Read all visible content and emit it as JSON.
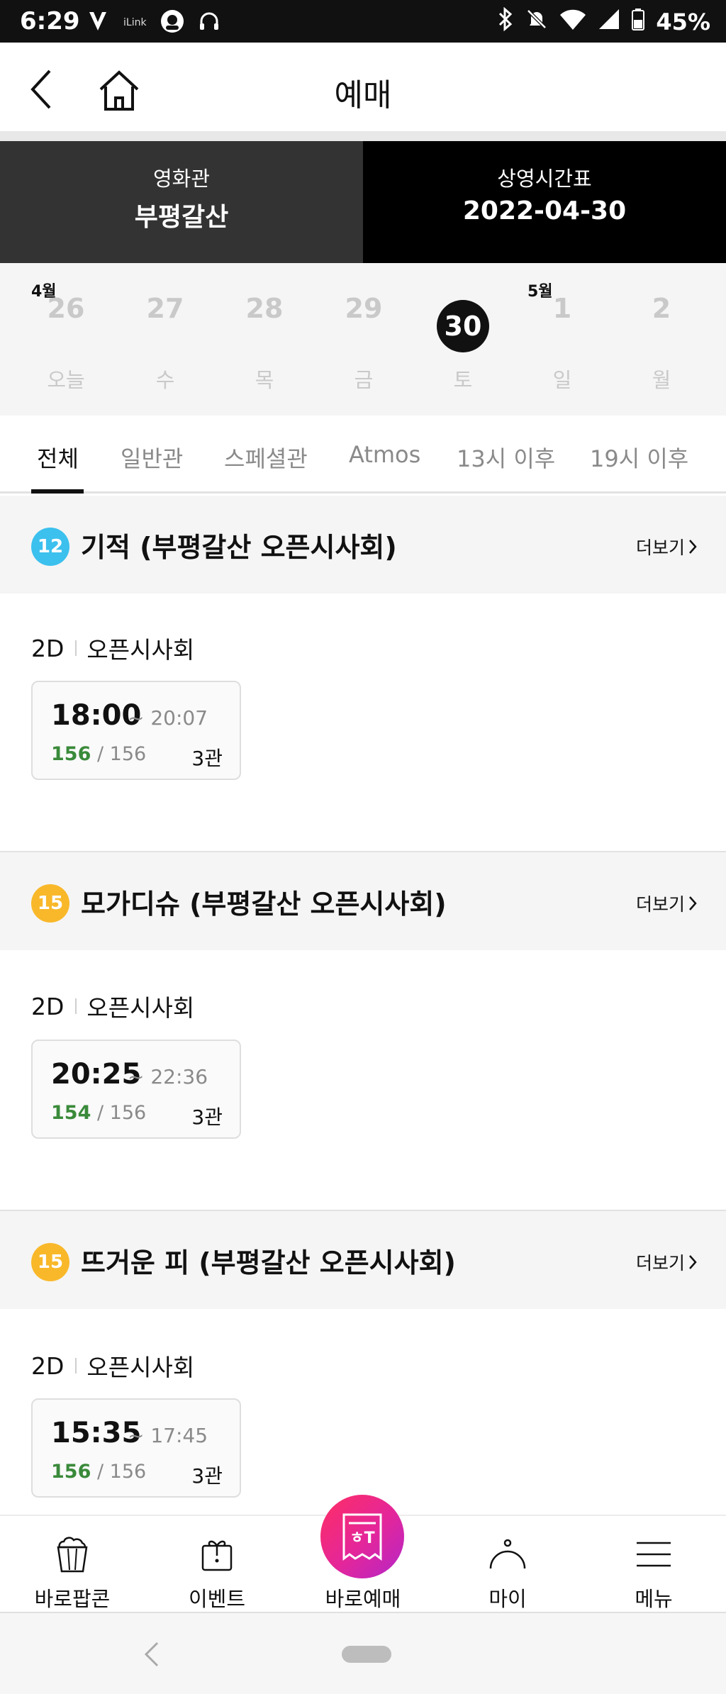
{
  "status_bar": {
    "time": "6:29",
    "battery": "45%",
    "left_icons": [
      "vpn-icon",
      "ilink-icon",
      "headset-app-icon",
      "headphones-icon"
    ],
    "right_icons": [
      "bluetooth-icon",
      "mute-icon",
      "wifi-icon",
      "signal-icon",
      "battery-icon"
    ],
    "ilink_label": "iLink"
  },
  "header": {
    "title": "예매",
    "back_icon": "chevron-left-icon",
    "home_icon": "home-icon"
  },
  "selector": {
    "theater_label": "영화관",
    "theater_value": "부평갈산",
    "schedule_label": "상영시간표",
    "schedule_value": "2022-04-30",
    "colors": {
      "theater_bg": "#333333",
      "schedule_bg": "#000000"
    }
  },
  "dates": {
    "months": [
      {
        "label": "4월"
      },
      {
        "label": "5월"
      }
    ],
    "days": [
      {
        "num": "26",
        "weekday": "오늘",
        "selected": false
      },
      {
        "num": "27",
        "weekday": "수",
        "selected": false
      },
      {
        "num": "28",
        "weekday": "목",
        "selected": false
      },
      {
        "num": "29",
        "weekday": "금",
        "selected": false
      },
      {
        "num": "30",
        "weekday": "토",
        "selected": true
      },
      {
        "num": "1",
        "weekday": "일",
        "selected": false
      },
      {
        "num": "2",
        "weekday": "월",
        "selected": false
      }
    ]
  },
  "tabs": [
    {
      "label": "전체",
      "active": true
    },
    {
      "label": "일반관",
      "active": false
    },
    {
      "label": "스페셜관",
      "active": false
    },
    {
      "label": "Atmos",
      "active": false
    },
    {
      "label": "13시 이후",
      "active": false
    },
    {
      "label": "19시 이후",
      "active": false
    }
  ],
  "movies": [
    {
      "rating": "12",
      "rating_color": "#3cc0ee",
      "title": "기적 (부평갈산 오픈시사회)",
      "more": "더보기",
      "format": "2D",
      "type": "오픈시사회",
      "showtime": {
        "start": "18:00",
        "end": "~ 20:07",
        "remaining": "156",
        "total": "/ 156",
        "hall": "3관"
      }
    },
    {
      "rating": "15",
      "rating_color": "#f9b82a",
      "title": "모가디슈 (부평갈산 오픈시사회)",
      "more": "더보기",
      "format": "2D",
      "type": "오픈시사회",
      "showtime": {
        "start": "20:25",
        "end": "~ 22:36",
        "remaining": "154",
        "total": "/ 156",
        "hall": "3관"
      }
    },
    {
      "rating": "15",
      "rating_color": "#f9b82a",
      "title": "뜨거운 피 (부평갈산 오픈시사회)",
      "more": "더보기",
      "format": "2D",
      "type": "오픈시사회",
      "showtime": {
        "start": "15:35",
        "end": "~ 17:45",
        "remaining": "156",
        "total": "/ 156",
        "hall": "3관"
      }
    }
  ],
  "bottom_nav": [
    {
      "label": "바로팝콘",
      "icon": "popcorn-icon"
    },
    {
      "label": "이벤트",
      "icon": "gift-icon"
    },
    {
      "label": "바로예매",
      "icon": "ticket-icon"
    },
    {
      "label": "마이",
      "icon": "person-icon"
    },
    {
      "label": "메뉴",
      "icon": "menu-icon"
    }
  ],
  "fab": {
    "text": "ㅎT",
    "colors": [
      "#ff2e63",
      "#b327c9"
    ]
  }
}
